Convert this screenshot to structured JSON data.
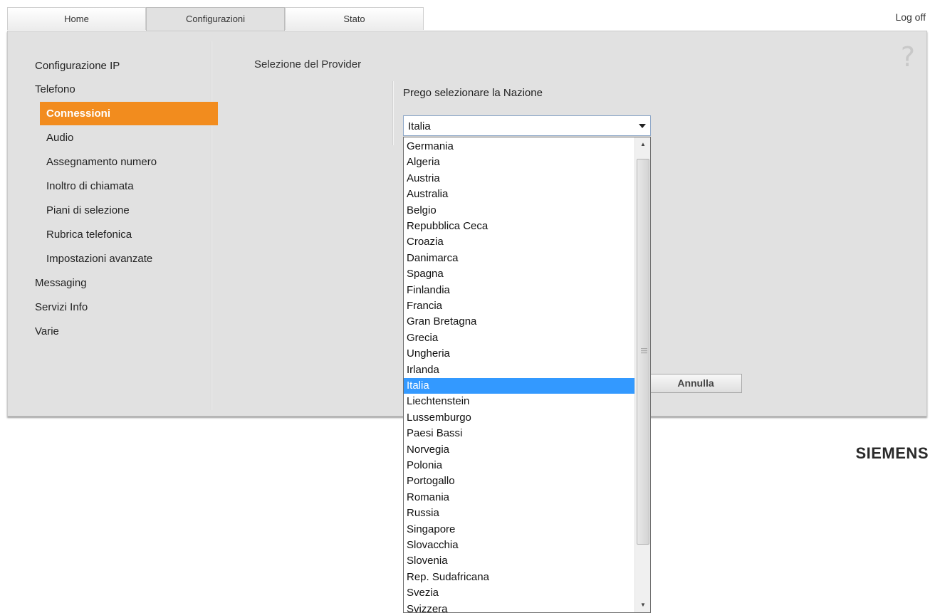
{
  "tabs": [
    {
      "label": "Home",
      "active": false
    },
    {
      "label": "Configurazioni",
      "active": true
    },
    {
      "label": "Stato",
      "active": false
    }
  ],
  "logoff": "Log off",
  "help_icon": "?",
  "nav": {
    "items": [
      {
        "label": "Configurazione IP"
      },
      {
        "label": "Telefono"
      },
      {
        "label": "Connessioni",
        "active": true
      },
      {
        "label": "Audio"
      },
      {
        "label": "Assegnamento numero"
      },
      {
        "label": "Inoltro di chiamata"
      },
      {
        "label": "Piani di selezione"
      },
      {
        "label": "Rubrica telefonica"
      },
      {
        "label": "Impostazioni avanzate"
      },
      {
        "label": "Messaging"
      },
      {
        "label": "Servizi Info"
      },
      {
        "label": "Varie"
      }
    ]
  },
  "section_title": "Selezione del Provider",
  "nation_label": "Prego selezionare la Nazione",
  "select": {
    "value": "Italia",
    "options": [
      "Germania",
      "Algeria",
      "Austria",
      "Australia",
      "Belgio",
      "Repubblica Ceca",
      "Croazia",
      "Danimarca",
      "Spagna",
      "Finlandia",
      "Francia",
      "Gran Bretagna",
      "Grecia",
      "Ungheria",
      "Irlanda",
      "Italia",
      "Liechtenstein",
      "Lussemburgo",
      "Paesi Bassi",
      "Norvegia",
      "Polonia",
      "Portogallo",
      "Romania",
      "Russia",
      "Singapore",
      "Slovacchia",
      "Slovenia",
      "Rep. Sudafricana",
      "Svezia",
      "Svizzera"
    ],
    "selected_index": 15
  },
  "annulla": "Annulla",
  "brand": "SIEMENS",
  "colors": {
    "accent": "#f28c1e",
    "selection": "#3399ff",
    "panel": "#e1e1e1"
  }
}
